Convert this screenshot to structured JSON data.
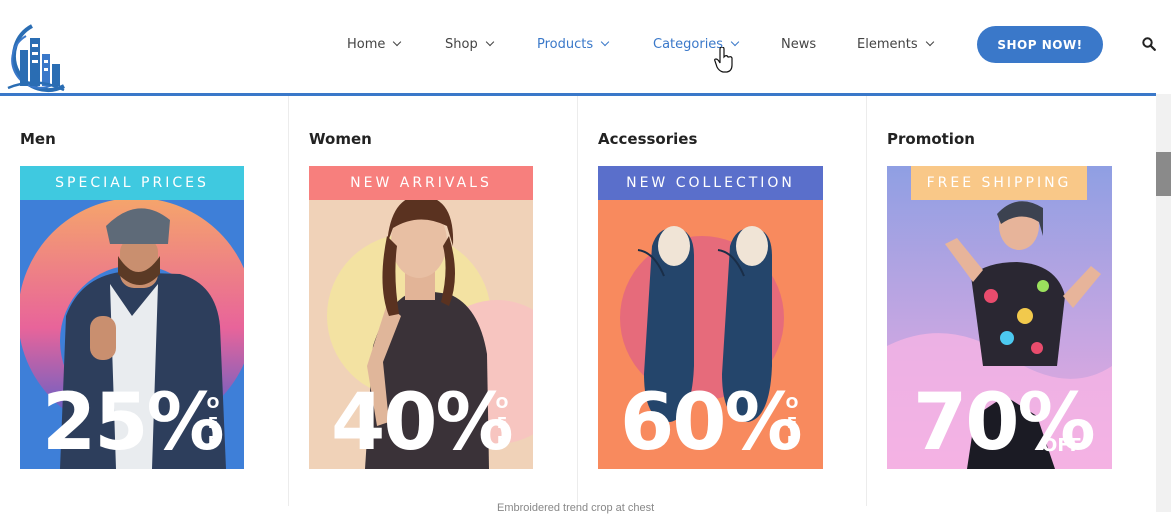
{
  "nav": {
    "items": [
      {
        "label": "Home",
        "has_dropdown": true,
        "active": false
      },
      {
        "label": "Shop",
        "has_dropdown": true,
        "active": false
      },
      {
        "label": "Products",
        "has_dropdown": true,
        "active": true
      },
      {
        "label": "Categories",
        "has_dropdown": true,
        "active": true
      },
      {
        "label": "News",
        "has_dropdown": false,
        "active": false
      },
      {
        "label": "Elements",
        "has_dropdown": true,
        "active": false
      }
    ],
    "cta_label": "SHOP NOW!",
    "search_icon": "search-icon"
  },
  "mega_menu": {
    "columns": [
      {
        "title": "Men",
        "banner": {
          "tag": "SPECIAL PRICES",
          "percent": "25%",
          "off": "OFF",
          "tag_color": "#3fc9e0"
        }
      },
      {
        "title": "Women",
        "banner": {
          "tag": "NEW ARRIVALS",
          "percent": "40%",
          "off": "OFF",
          "tag_color": "#f77f7d"
        }
      },
      {
        "title": "Accessories",
        "banner": {
          "tag": "NEW COLLECTION",
          "percent": "60%",
          "off": "OFF",
          "tag_color": "#5a6fcb"
        }
      },
      {
        "title": "Promotion",
        "banner": {
          "tag": "FREE SHIPPING",
          "percent": "70%",
          "off": "OFF",
          "tag_color": "#f9c888"
        }
      }
    ]
  },
  "colors": {
    "accent": "#3a78c9"
  },
  "bottom_text": "Embroidered trend crop at chest"
}
